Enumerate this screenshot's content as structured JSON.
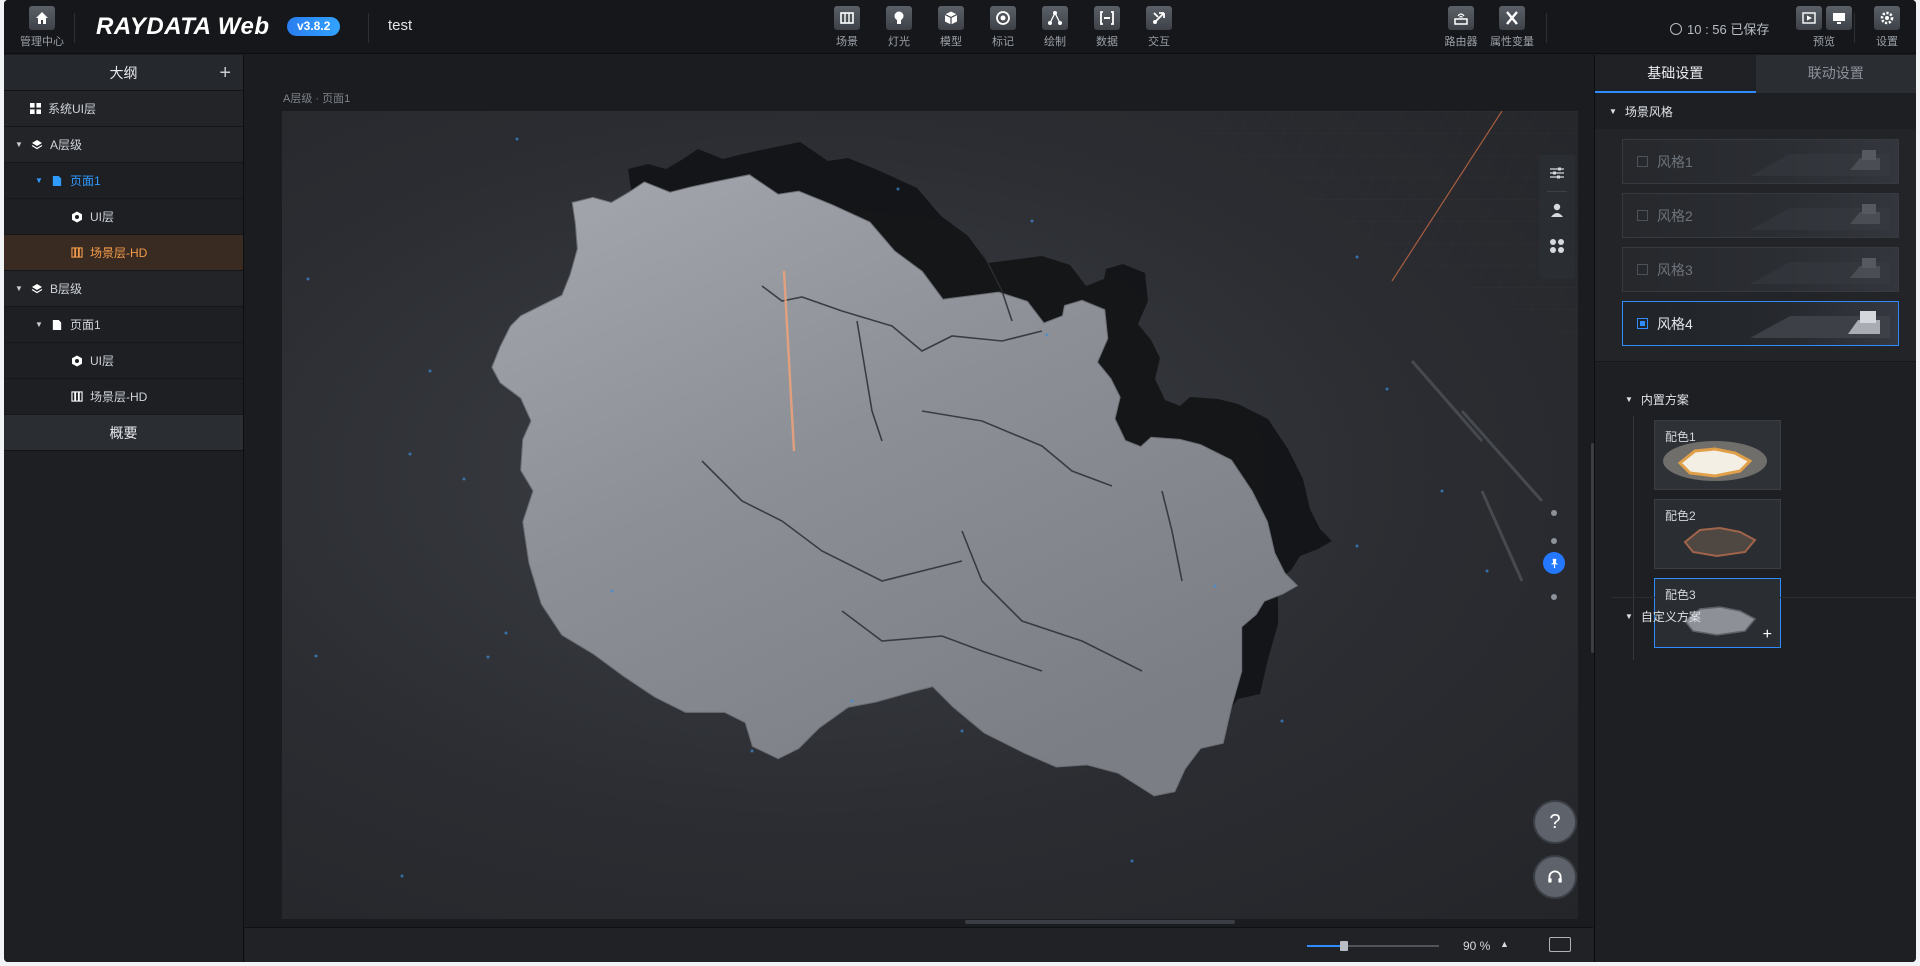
{
  "topbar": {
    "mgmt_label": "管理中心",
    "logo": "RAYDATA Web",
    "version": "v3.8.2",
    "project_name": "test",
    "tools": [
      {
        "label": "场景",
        "icon": "scene-icon"
      },
      {
        "label": "灯光",
        "icon": "light-icon"
      },
      {
        "label": "模型",
        "icon": "model-icon"
      },
      {
        "label": "标记",
        "icon": "marker-icon"
      },
      {
        "label": "绘制",
        "icon": "draw-icon"
      },
      {
        "label": "数据",
        "icon": "data-icon"
      },
      {
        "label": "交互",
        "icon": "interact-icon"
      }
    ],
    "router_label": "路由器",
    "attr_label": "属性变量",
    "save_status": "10 : 56 已保存",
    "preview_label": "预览",
    "settings_label": "设置"
  },
  "outline": {
    "title": "大纲",
    "items": [
      {
        "label": "系统UI层",
        "level": 0,
        "icon": "grid-icon",
        "state": "normal"
      },
      {
        "label": "A层级",
        "level": 0,
        "icon": "layers-icon",
        "state": "normal",
        "expanded": true
      },
      {
        "label": "页面1",
        "level": 1,
        "icon": "page-icon",
        "state": "blue",
        "expanded": true
      },
      {
        "label": "UI层",
        "level": 2,
        "icon": "ui-layer-icon",
        "state": "normal"
      },
      {
        "label": "场景层-HD",
        "level": 2,
        "icon": "scene-layer-icon",
        "state": "orange"
      },
      {
        "label": "B层级",
        "level": 0,
        "icon": "layers-icon",
        "state": "normal",
        "expanded": true
      },
      {
        "label": "页面1",
        "level": 1,
        "icon": "page-icon",
        "state": "normal",
        "expanded": true
      },
      {
        "label": "UI层",
        "level": 2,
        "icon": "ui-layer-icon",
        "state": "normal"
      },
      {
        "label": "场景层-HD",
        "level": 2,
        "icon": "scene-layer-icon",
        "state": "normal"
      }
    ],
    "overview_title": "概要"
  },
  "canvas": {
    "breadcrumb": "A层级 · 页面1",
    "help_label": "?",
    "zoom": "90 %",
    "zoom_fraction": 0.28
  },
  "right": {
    "tabs": [
      "基础设置",
      "联动设置"
    ],
    "active_tab": 0,
    "scene_style_title": "场景风格",
    "styles": [
      {
        "label": "风格1",
        "selected": false
      },
      {
        "label": "风格2",
        "selected": false
      },
      {
        "label": "风格3",
        "selected": false
      },
      {
        "label": "风格4",
        "selected": true
      }
    ],
    "builtin_title": "内置方案",
    "swatches": [
      {
        "label": "配色1",
        "selected": false
      },
      {
        "label": "配色2",
        "selected": false
      },
      {
        "label": "配色3",
        "selected": true
      }
    ],
    "custom_title": "自定义方案"
  },
  "colors": {
    "accent": "#2e8cff",
    "orange": "#f39b4a",
    "panel": "#1d1f23",
    "map_fill": "#8e9298"
  }
}
